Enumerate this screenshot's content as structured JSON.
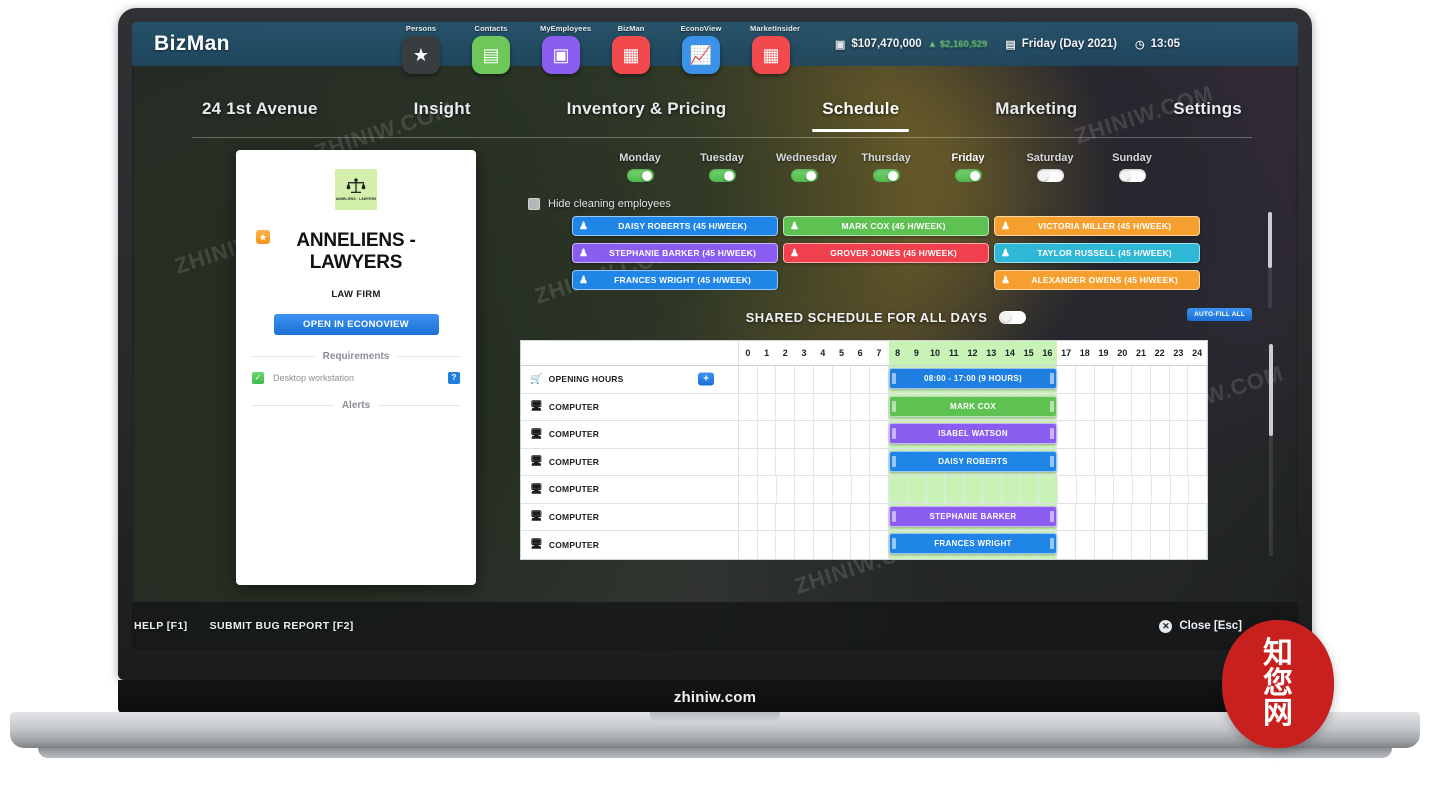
{
  "app": {
    "logo": "BizMan",
    "watermark_center": "zhiniw.com",
    "watermark_diagonal": "ZHINIW.COM",
    "seal_chars": [
      "知",
      "您",
      "网"
    ]
  },
  "app_switcher": [
    {
      "label": "Persons",
      "icon": "star-icon",
      "glyph": "★",
      "color": "#3a3d40",
      "active": false
    },
    {
      "label": "Contacts",
      "icon": "chat-icon",
      "glyph": "▤",
      "color": "#6dc75a",
      "active": false
    },
    {
      "label": "MyEmployees",
      "icon": "id-card-icon",
      "glyph": "▣",
      "color": "#8b5cf0",
      "active": false
    },
    {
      "label": "BizMan",
      "icon": "store-icon",
      "glyph": "▦",
      "color": "#f2494c",
      "active": true
    },
    {
      "label": "EconoView",
      "icon": "chart-line-icon",
      "glyph": "📈",
      "color": "#3b92e8",
      "active": false
    },
    {
      "label": "MarketInsider",
      "icon": "store-icon",
      "glyph": "▦",
      "color": "#f2494c",
      "active": false
    }
  ],
  "status": {
    "money_icon": "money-icon",
    "money": "$107,470,000",
    "money_delta": "▲ $2,160,529",
    "calendar_icon": "calendar-icon",
    "date": "Friday (Day 2021)",
    "clock_icon": "clock-icon",
    "time": "13:05"
  },
  "nav_tabs": [
    {
      "label": "24 1st Avenue",
      "active": false
    },
    {
      "label": "Insight",
      "active": false
    },
    {
      "label": "Inventory & Pricing",
      "active": false
    },
    {
      "label": "Schedule",
      "active": true
    },
    {
      "label": "Marketing",
      "active": false
    },
    {
      "label": "Settings",
      "active": false
    }
  ],
  "company_card": {
    "logo_icon": "scales-of-justice-icon",
    "logo_glyph": "⚖",
    "logo_subtext": "ANNELIENS · LAWYERS",
    "badge": "★",
    "name": "ANNELIENS - LAWYERS",
    "type": "LAW FIRM",
    "open_button": "OPEN IN ECONOVIEW",
    "requirements_title": "Requirements",
    "requirements": [
      {
        "label": "Desktop workstation",
        "checked": true,
        "help": "?"
      }
    ],
    "alerts_title": "Alerts"
  },
  "schedule": {
    "days": [
      {
        "name": "Monday",
        "on": true,
        "selected": false
      },
      {
        "name": "Tuesday",
        "on": true,
        "selected": false
      },
      {
        "name": "Wednesday",
        "on": true,
        "selected": false
      },
      {
        "name": "Thursday",
        "on": true,
        "selected": false
      },
      {
        "name": "Friday",
        "on": true,
        "selected": true
      },
      {
        "name": "Saturday",
        "on": false,
        "selected": false
      },
      {
        "name": "Sunday",
        "on": false,
        "selected": false
      }
    ],
    "hide_cleaning_label": "Hide cleaning employees",
    "hide_cleaning_checked": false,
    "employees": [
      {
        "name": "DAISY ROBERTS (45 H/WEEK)",
        "color": "#1f86e8"
      },
      {
        "name": "MARK COX (45 H/WEEK)",
        "color": "#5dc251"
      },
      {
        "name": "VICTORIA MILLER (45 H/WEEK)",
        "color": "#f5a02e"
      },
      {
        "name": "STEPHANIE BARKER (45 H/WEEK)",
        "color": "#8b5cf0"
      },
      {
        "name": "GROVER JONES (45 H/WEEK)",
        "color": "#f0404e"
      },
      {
        "name": "TAYLOR RUSSELL (45 H/WEEK)",
        "color": "#2fb8d6"
      },
      {
        "name": "FRANCES WRIGHT (45 H/WEEK)",
        "color": "#1f86e8"
      },
      {
        "name": "",
        "color": "transparent",
        "placeholder": true
      },
      {
        "name": "ALEXANDER OWENS (45 H/WEEK)",
        "color": "#f5a02e"
      }
    ],
    "shared_label": "SHARED SCHEDULE FOR ALL DAYS",
    "shared_on": false,
    "auto_fill_label": "AUTO-FILL ALL",
    "hours": [
      "0",
      "1",
      "2",
      "3",
      "4",
      "5",
      "6",
      "7",
      "8",
      "9",
      "10",
      "11",
      "12",
      "13",
      "14",
      "15",
      "16",
      "17",
      "18",
      "19",
      "20",
      "21",
      "22",
      "23",
      "24"
    ],
    "open_from_hour": 8,
    "open_to_hour": 17,
    "rows": [
      {
        "label": "OPENING HOURS",
        "icon": "shop-icon",
        "glyph": "🛒",
        "has_add": true,
        "add_label": "+",
        "bar": {
          "text": "08:00 - 17:00 (9 HOURS)",
          "color": "#1f7fe0",
          "start": 8,
          "end": 17
        }
      },
      {
        "label": "COMPUTER",
        "icon": "computer-icon",
        "glyph": "🖥",
        "has_add": false,
        "bar": {
          "text": "MARK COX",
          "color": "#5dc251",
          "start": 8,
          "end": 17
        }
      },
      {
        "label": "COMPUTER",
        "icon": "computer-icon",
        "glyph": "🖥",
        "has_add": false,
        "bar": {
          "text": "ISABEL WATSON",
          "color": "#8b5cf0",
          "start": 8,
          "end": 17
        }
      },
      {
        "label": "COMPUTER",
        "icon": "computer-icon",
        "glyph": "🖥",
        "has_add": false,
        "bar": {
          "text": "DAISY ROBERTS",
          "color": "#1f86e8",
          "start": 8,
          "end": 17
        }
      },
      {
        "label": "COMPUTER",
        "icon": "computer-icon",
        "glyph": "🖥",
        "has_add": false,
        "bar": null
      },
      {
        "label": "COMPUTER",
        "icon": "computer-icon",
        "glyph": "🖥",
        "has_add": false,
        "bar": {
          "text": "STEPHANIE BARKER",
          "color": "#8b5cf0",
          "start": 8,
          "end": 17
        }
      },
      {
        "label": "COMPUTER",
        "icon": "computer-icon",
        "glyph": "🖥",
        "has_add": false,
        "bar": {
          "text": "FRANCES WRIGHT",
          "color": "#1f86e8",
          "start": 8,
          "end": 17
        }
      }
    ]
  },
  "bottom": {
    "help": "HELP [F1]",
    "bug_report": "SUBMIT BUG REPORT [F2]",
    "close_icon": "close-icon",
    "close_glyph": "✕",
    "close_label": "Close [Esc]"
  },
  "colors": {
    "accent_blue": "#1f7fe0",
    "topbar_blue": "#265570",
    "open_green": "#c9f2b6"
  }
}
